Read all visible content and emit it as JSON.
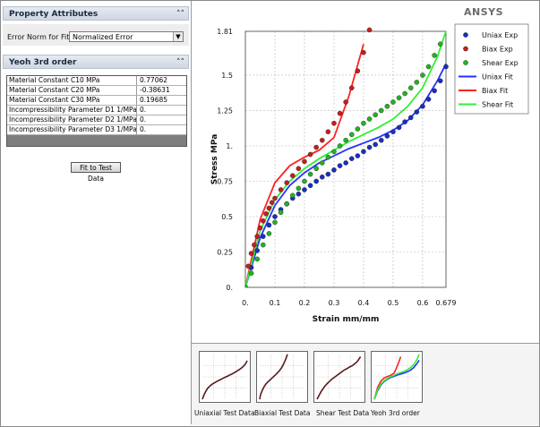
{
  "left_panel": {
    "property_header": "Property Attributes",
    "error_norm_label": "Error Norm for Fit",
    "error_norm_value": "Normalized Error",
    "yeoh_header": "Yeoh 3rd order",
    "table": [
      {
        "name": "Material Constant C10 MPa",
        "value": "0.77062"
      },
      {
        "name": "Material Constant C20 MPa",
        "value": "-0.38631"
      },
      {
        "name": "Material Constant C30 MPa",
        "value": "0.19685"
      },
      {
        "name": "Incompressibility Parameter D1 1/MPa",
        "value": "0."
      },
      {
        "name": "Incompressibility Parameter D2 1/MPa",
        "value": "0."
      },
      {
        "name": "Incompressibility Parameter D3 1/MPa",
        "value": "0."
      }
    ],
    "fit_button": "Fit to Test Data"
  },
  "logo_text": "ANSYS",
  "thumbnails": [
    {
      "label": "Uniaxial Test Data"
    },
    {
      "label": "Biaxial Test Data"
    },
    {
      "label": "Shear Test Data"
    },
    {
      "label": "Yeoh 3rd order"
    }
  ],
  "colors": {
    "uniax": "#1a2fbf",
    "biax": "#c21f1f",
    "shear": "#22b322",
    "uniax_fit": "#2233ff",
    "biax_fit": "#ff2222",
    "shear_fit": "#33ee33"
  },
  "chart_data": {
    "type": "scatter",
    "xlabel": "Strain mm/mm",
    "ylabel": "Stress MPa",
    "xlim": [
      0,
      0.679
    ],
    "ylim": [
      0,
      1.81
    ],
    "xticks": [
      "0.",
      "0.1",
      "0.2",
      "0.3",
      "0.4",
      "0.5",
      "0.6",
      "0.679"
    ],
    "yticks": [
      "0.",
      "0.25",
      "0.5",
      "0.75",
      "1.",
      "1.25",
      "1.5",
      "1.81"
    ],
    "xtick_values": [
      0,
      0.1,
      0.2,
      0.3,
      0.4,
      0.5,
      0.6,
      0.679
    ],
    "ytick_values": [
      0,
      0.25,
      0.5,
      0.75,
      1.0,
      1.25,
      1.5,
      1.81
    ],
    "legend_position": "top-right",
    "grid": true,
    "series": [
      {
        "name": "Uniax Exp",
        "kind": "points",
        "color": "#1a2fbf",
        "x": [
          0,
          0.02,
          0.04,
          0.06,
          0.08,
          0.1,
          0.12,
          0.14,
          0.16,
          0.18,
          0.2,
          0.22,
          0.24,
          0.26,
          0.28,
          0.3,
          0.32,
          0.34,
          0.36,
          0.38,
          0.4,
          0.42,
          0.44,
          0.46,
          0.48,
          0.5,
          0.52,
          0.54,
          0.56,
          0.58,
          0.6,
          0.62,
          0.64,
          0.66,
          0.679
        ],
        "y": [
          0,
          0.14,
          0.26,
          0.36,
          0.44,
          0.5,
          0.55,
          0.59,
          0.63,
          0.66,
          0.69,
          0.72,
          0.75,
          0.78,
          0.8,
          0.83,
          0.86,
          0.88,
          0.91,
          0.93,
          0.96,
          0.99,
          1.01,
          1.04,
          1.07,
          1.1,
          1.13,
          1.17,
          1.2,
          1.24,
          1.28,
          1.33,
          1.39,
          1.46,
          1.56
        ]
      },
      {
        "name": "Biax Exp",
        "kind": "points",
        "color": "#c21f1f",
        "x": [
          0,
          0.01,
          0.02,
          0.03,
          0.04,
          0.05,
          0.06,
          0.07,
          0.08,
          0.09,
          0.1,
          0.12,
          0.14,
          0.16,
          0.18,
          0.2,
          0.22,
          0.24,
          0.26,
          0.28,
          0.3,
          0.32,
          0.34,
          0.36,
          0.38,
          0.4,
          0.42
        ],
        "y": [
          0,
          0.15,
          0.24,
          0.3,
          0.36,
          0.42,
          0.47,
          0.52,
          0.56,
          0.6,
          0.63,
          0.69,
          0.74,
          0.79,
          0.84,
          0.89,
          0.94,
          0.99,
          1.04,
          1.1,
          1.16,
          1.23,
          1.31,
          1.41,
          1.53,
          1.66,
          1.82
        ]
      },
      {
        "name": "Shear Exp",
        "kind": "points",
        "color": "#22b322",
        "x": [
          0,
          0.02,
          0.04,
          0.06,
          0.08,
          0.1,
          0.12,
          0.14,
          0.16,
          0.18,
          0.2,
          0.22,
          0.24,
          0.26,
          0.28,
          0.3,
          0.32,
          0.34,
          0.36,
          0.38,
          0.4,
          0.42,
          0.44,
          0.46,
          0.48,
          0.5,
          0.52,
          0.54,
          0.56,
          0.58,
          0.6,
          0.62,
          0.64,
          0.66
        ],
        "y": [
          0,
          0.1,
          0.2,
          0.3,
          0.38,
          0.46,
          0.53,
          0.59,
          0.65,
          0.7,
          0.75,
          0.8,
          0.84,
          0.88,
          0.92,
          0.96,
          1.0,
          1.04,
          1.08,
          1.12,
          1.16,
          1.19,
          1.22,
          1.25,
          1.28,
          1.31,
          1.34,
          1.37,
          1.41,
          1.45,
          1.5,
          1.56,
          1.64,
          1.72
        ]
      },
      {
        "name": "Uniax Fit",
        "kind": "line",
        "color": "#2233ff",
        "x": [
          0,
          0.05,
          0.1,
          0.15,
          0.2,
          0.25,
          0.3,
          0.35,
          0.4,
          0.45,
          0.5,
          0.55,
          0.6,
          0.65,
          0.679
        ],
        "y": [
          0,
          0.35,
          0.58,
          0.72,
          0.81,
          0.88,
          0.93,
          0.98,
          1.02,
          1.06,
          1.11,
          1.18,
          1.29,
          1.46,
          1.58
        ]
      },
      {
        "name": "Biax Fit",
        "kind": "line",
        "color": "#ff2222",
        "x": [
          0,
          0.05,
          0.1,
          0.15,
          0.2,
          0.25,
          0.3,
          0.35,
          0.4
        ],
        "y": [
          0,
          0.48,
          0.74,
          0.86,
          0.92,
          0.97,
          1.06,
          1.35,
          1.72
        ]
      },
      {
        "name": "Shear Fit",
        "kind": "line",
        "color": "#33ee33",
        "x": [
          0,
          0.05,
          0.1,
          0.15,
          0.2,
          0.25,
          0.3,
          0.35,
          0.4,
          0.45,
          0.5,
          0.55,
          0.6,
          0.65,
          0.679
        ],
        "y": [
          0,
          0.4,
          0.62,
          0.75,
          0.84,
          0.91,
          0.97,
          1.03,
          1.08,
          1.13,
          1.19,
          1.28,
          1.41,
          1.63,
          1.81
        ]
      }
    ]
  }
}
